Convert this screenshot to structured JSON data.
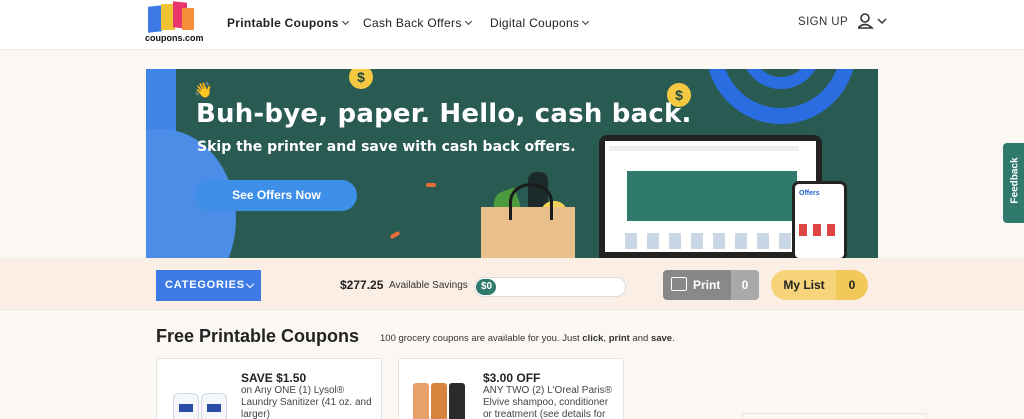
{
  "header": {
    "logo_text": "coupons.com",
    "nav": [
      {
        "label": "Printable Coupons"
      },
      {
        "label": "Cash Back Offers"
      },
      {
        "label": "Digital Coupons"
      }
    ],
    "signup_label": "SIGN UP",
    "user_icon": "user-icon"
  },
  "hero": {
    "emoji": "👋",
    "headline": "Buh-bye, paper. Hello, cash back.",
    "subhead": "Skip the printer and save with cash back offers.",
    "cta_label": "See Offers Now",
    "coin_symbol": "$",
    "phone_title": "Offers",
    "colors": {
      "background": "#2a5b52",
      "accent": "#3d8fe8",
      "coin": "#f5c842"
    }
  },
  "feedback_label": "Feedback",
  "toolbar": {
    "categories_label": "CATEGORIES",
    "savings_amount": "$277.25",
    "savings_label": "Available Savings",
    "progress_value": "$0",
    "progress_fraction": 0.13,
    "print_label": "Print",
    "print_count": "0",
    "mylist_label": "My List",
    "mylist_count": "0"
  },
  "coupons": {
    "title": "Free Printable Coupons",
    "subtitle_prefix": "100 grocery coupons are available for you. Just ",
    "subtitle_click": "click",
    "subtitle_mid1": ", ",
    "subtitle_print": "print",
    "subtitle_mid2": " and ",
    "subtitle_save": "save",
    "subtitle_end": ".",
    "cards": [
      {
        "title": "SAVE $1.50",
        "description": "on Any ONE (1) Lysol® Laundry Sanitizer (41 oz. and larger)"
      },
      {
        "title": "$3.00 OFF",
        "description": "ANY TWO (2) L'Oreal Paris® Elvive shampoo, conditioner or treatment (see details for"
      }
    ]
  }
}
